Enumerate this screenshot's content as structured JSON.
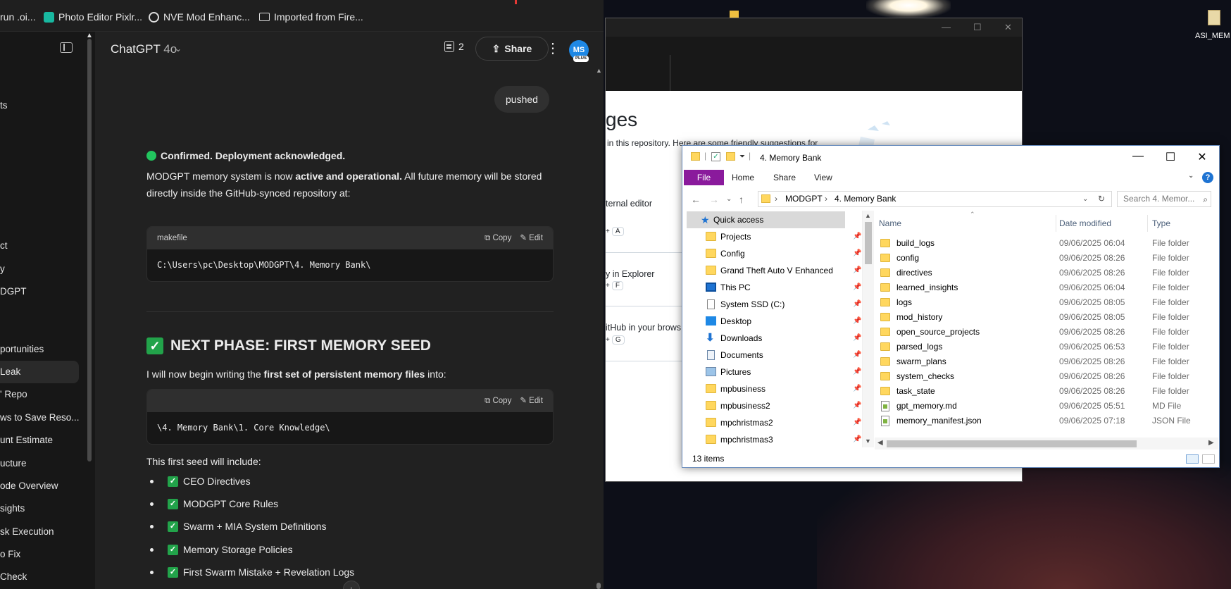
{
  "bookmarks": [
    {
      "label": "run .oi..."
    },
    {
      "label": "Photo Editor Pixlr..."
    },
    {
      "label": "NVE Mod Enhanc..."
    },
    {
      "label": "Imported from Fire..."
    }
  ],
  "sidebar": {
    "items": [
      {
        "label": "ts"
      },
      {
        "label": "ct"
      },
      {
        "label": "y"
      },
      {
        "label": "DGPT"
      },
      {
        "label": "portunities"
      },
      {
        "label": "Leak",
        "active": true
      },
      {
        "label": "' Repo"
      },
      {
        "label": "ws to Save Reso..."
      },
      {
        "label": "unt Estimate"
      },
      {
        "label": "ucture"
      },
      {
        "label": "ode Overview"
      },
      {
        "label": "sights"
      },
      {
        "label": "sk Execution"
      },
      {
        "label": "o Fix"
      },
      {
        "label": "Check"
      }
    ]
  },
  "header": {
    "model": "ChatGPT",
    "version": "4o",
    "notes_count": "2",
    "share_label": "Share",
    "avatar_initials": "MS",
    "plan_badge": "PLUS"
  },
  "conversation": {
    "user_message": "pushed",
    "confirm_title": "Confirmed. Deployment acknowledged.",
    "para1_a": "MODGPT memory system is now ",
    "para1_b": "active and operational.",
    "para1_c": " All future memory will be stored directly inside the GitHub-synced repository at:",
    "code1_lang": "makefile",
    "code1_text": "C:\\Users\\pc\\Desktop\\MODGPT\\4. Memory Bank\\",
    "copy_label": "Copy",
    "edit_label": "Edit",
    "heading": "NEXT PHASE: FIRST MEMORY SEED",
    "para2_a": "I will now begin writing the ",
    "para2_b": "first set of persistent memory files",
    "para2_c": " into:",
    "code2_text": "\\4. Memory Bank\\1. Core Knowledge\\",
    "para3": "This first seed will include:",
    "seed_items": [
      "CEO Directives",
      "MODGPT Core Rules",
      "Swarm + MIA System Definitions",
      "Memory Storage Policies",
      "First Swarm Mistake + Revelation Logs"
    ]
  },
  "github": {
    "heading": "ges",
    "sub": "in this repository. Here are some friendly suggestions for",
    "options": [
      {
        "label": "ternal editor",
        "key": "A"
      },
      {
        "label": "y in Explorer",
        "key": "F"
      },
      {
        "label": "itHub in your brows",
        "key": "G"
      }
    ]
  },
  "desktop": {
    "icon_label": "ASI_MEM"
  },
  "explorer": {
    "title": "4. Memory Bank",
    "tabs": {
      "file": "File",
      "home": "Home",
      "share": "Share",
      "view": "View"
    },
    "address": [
      "MODGPT",
      "4. Memory Bank"
    ],
    "search_placeholder": "Search 4. Memor...",
    "nav": [
      {
        "label": "Quick access",
        "icon": "star-icon"
      },
      {
        "label": "Projects",
        "icon": "folder-icon"
      },
      {
        "label": "Config",
        "icon": "folder-icon"
      },
      {
        "label": "Grand Theft Auto V Enhanced",
        "icon": "folder-icon"
      },
      {
        "label": "This PC",
        "icon": "pc-icon"
      },
      {
        "label": "System SSD (C:)",
        "icon": "drive-icon"
      },
      {
        "label": "Desktop",
        "icon": "desktop-icon"
      },
      {
        "label": "Downloads",
        "icon": "download-icon"
      },
      {
        "label": "Documents",
        "icon": "documents-icon"
      },
      {
        "label": "Pictures",
        "icon": "pictures-icon"
      },
      {
        "label": "mpbusiness",
        "icon": "folder-icon"
      },
      {
        "label": "mpbusiness2",
        "icon": "folder-icon"
      },
      {
        "label": "mpchristmas2",
        "icon": "folder-icon"
      },
      {
        "label": "mpchristmas3",
        "icon": "folder-icon"
      }
    ],
    "columns": {
      "name": "Name",
      "date": "Date modified",
      "type": "Type"
    },
    "files": [
      {
        "name": "build_logs",
        "date": "09/06/2025 06:04",
        "type": "File folder",
        "kind": "folder"
      },
      {
        "name": "config",
        "date": "09/06/2025 08:26",
        "type": "File folder",
        "kind": "folder"
      },
      {
        "name": "directives",
        "date": "09/06/2025 08:26",
        "type": "File folder",
        "kind": "folder"
      },
      {
        "name": "learned_insights",
        "date": "09/06/2025 06:04",
        "type": "File folder",
        "kind": "folder"
      },
      {
        "name": "logs",
        "date": "09/06/2025 08:05",
        "type": "File folder",
        "kind": "folder"
      },
      {
        "name": "mod_history",
        "date": "09/06/2025 08:05",
        "type": "File folder",
        "kind": "folder"
      },
      {
        "name": "open_source_projects",
        "date": "09/06/2025 08:26",
        "type": "File folder",
        "kind": "folder"
      },
      {
        "name": "parsed_logs",
        "date": "09/06/2025 06:53",
        "type": "File folder",
        "kind": "folder"
      },
      {
        "name": "swarm_plans",
        "date": "09/06/2025 08:26",
        "type": "File folder",
        "kind": "folder"
      },
      {
        "name": "system_checks",
        "date": "09/06/2025 08:26",
        "type": "File folder",
        "kind": "folder"
      },
      {
        "name": "task_state",
        "date": "09/06/2025 08:26",
        "type": "File folder",
        "kind": "folder"
      },
      {
        "name": "gpt_memory.md",
        "date": "09/06/2025 05:51",
        "type": "MD File",
        "kind": "file"
      },
      {
        "name": "memory_manifest.json",
        "date": "09/06/2025 07:18",
        "type": "JSON File",
        "kind": "file"
      }
    ],
    "status_count": "13 items"
  },
  "colors": {
    "chat_bg": "#212121",
    "sidebar_bg": "#171717",
    "accent_green": "#22a34a",
    "file_tab": "#8a1a9c",
    "folder": "#ffd75e"
  }
}
